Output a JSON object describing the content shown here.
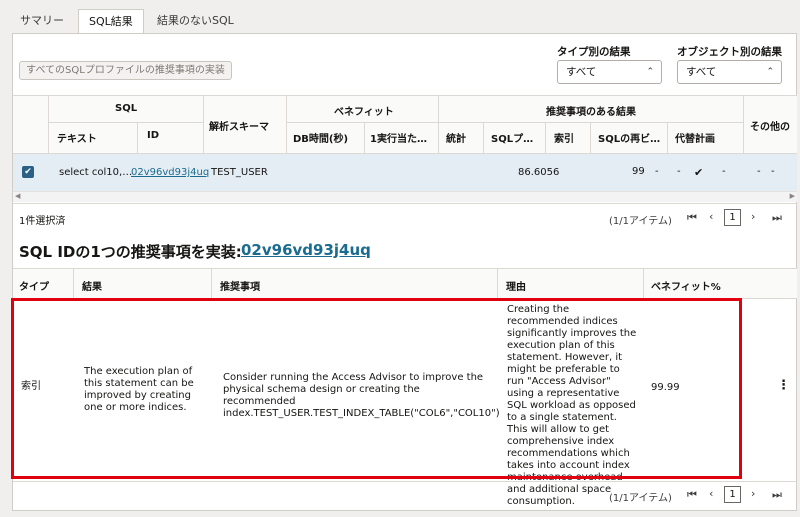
{
  "tabs": [
    {
      "label": "サマリー"
    },
    {
      "label": "SQL結果"
    },
    {
      "label": "結果のないSQL"
    }
  ],
  "toolbar": {
    "implement_all_label": "すべてのSQLプロファイルの推奨事項の実装"
  },
  "filters": {
    "by_type_label": "タイプ別の結果",
    "by_type_value": "すべて",
    "by_object_label": "オブジェクト別の結果",
    "by_object_value": "すべて"
  },
  "sql_grid": {
    "group_headers": {
      "sql": "SQL",
      "schema": "解析スキーマ",
      "benefit": "ベネフィット",
      "results": "推奨事項のある結果",
      "other": "その他の"
    },
    "sub_headers": {
      "text": "テキスト",
      "id": "ID",
      "db_time": "DB時間(秒)",
      "per_exec": "1実行当た…",
      "stats": "統計",
      "sql_profile": "SQLプ…",
      "index": "索引",
      "restructure": "SQLの再ビ…",
      "alt_plan": "代替計画"
    },
    "row": {
      "selected": true,
      "text": "select col10,…",
      "id": "02v96vd93j4uq",
      "schema": "TEST_USER",
      "sql_profile": "86.6056",
      "restructure": "99",
      "dash": "-",
      "check": "✔"
    }
  },
  "status": {
    "selected_count": "1件選択済"
  },
  "pagination": {
    "items_text": "(1/1アイテム)",
    "page": "1"
  },
  "detail": {
    "title": "SQL IDの1つの推奨事項を実装:",
    "sql_id": "02v96vd93j4uq",
    "headers": {
      "type": "タイプ",
      "finding": "結果",
      "recommendation": "推奨事項",
      "rationale": "理由",
      "benefit": "ベネフィット%"
    },
    "row": {
      "type": "索引",
      "finding": "The execution plan of this statement can be improved by creating one or more indices.",
      "recommendation": "Consider running the Access Advisor to improve the physical schema design or creating the recommended index.TEST_USER.TEST_INDEX_TABLE(\"COL6\",\"COL10\")",
      "rationale": "Creating the recommended indices significantly improves the execution plan of this statement. However, it might be preferable to run \"Access Advisor\" using a representative SQL workload as opposed to a single statement. This will allow to get comprehensive index recommendations which takes into account index maintenance overhead and additional space consumption.",
      "benefit": "99.99",
      "menu": "⋮"
    }
  },
  "icons": {
    "first": "K",
    "prev": "‹",
    "next": "›",
    "last": "K",
    "caret": "⌃⌄"
  },
  "colors": {
    "highlight": "#e0000f",
    "link": "#1a6b8f",
    "selected_row": "#e4edf4"
  }
}
